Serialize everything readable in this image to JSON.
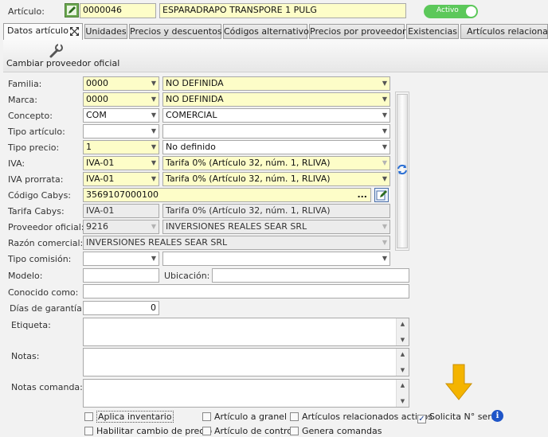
{
  "header": {
    "articulo_label": "Artículo:",
    "code": "0000046",
    "description": "ESPARADRAPO TRANSPORE 1 PULG",
    "toggle_label": "Activo"
  },
  "tabs": [
    {
      "label": "Datos artículo"
    },
    {
      "label": "Unidades"
    },
    {
      "label": "Precios y descuentos"
    },
    {
      "label": "Códigos alternativos"
    },
    {
      "label": "Precios por proveedor"
    },
    {
      "label": "Existencias"
    },
    {
      "label": "Artículos relacionados"
    }
  ],
  "toolbar": {
    "change_provider_label": "Cambiar proveedor oficial"
  },
  "form": {
    "familia": {
      "label": "Familia:",
      "code": "0000",
      "value": "NO DEFINIDA"
    },
    "marca": {
      "label": "Marca:",
      "code": "0000",
      "value": "NO DEFINIDA"
    },
    "concepto": {
      "label": "Concepto:",
      "code": "COM",
      "value": "COMERCIAL"
    },
    "tipo_articulo": {
      "label": "Tipo artículo:",
      "code": "",
      "value": ""
    },
    "tipo_precio": {
      "label": "Tipo precio:",
      "code": "1",
      "value": "No definido"
    },
    "iva": {
      "label": "IVA:",
      "code": "IVA-01",
      "value": "Tarifa 0% (Artículo 32, núm. 1, RLIVA)"
    },
    "iva_prorrata": {
      "label": "IVA prorrata:",
      "code": "IVA-01",
      "value": "Tarifa 0% (Artículo 32, núm. 1, RLIVA)"
    },
    "codigo_cabys": {
      "label": "Código Cabys:",
      "value": "3569107000100",
      "ellipsis": "..."
    },
    "tarifa_cabys": {
      "label": "Tarifa Cabys:",
      "code": "IVA-01",
      "value": "Tarifa 0% (Artículo 32, núm. 1, RLIVA)"
    },
    "proveedor_oficial": {
      "label": "Proveedor oficial:",
      "code": "9216",
      "value": "INVERSIONES REALES SEAR SRL"
    },
    "razon_comercial": {
      "label": "Razón comercial:",
      "value": "INVERSIONES REALES SEAR SRL"
    },
    "tipo_comision": {
      "label": "Tipo comisión:",
      "code": "",
      "value": ""
    },
    "modelo": {
      "label": "Modelo:",
      "value": ""
    },
    "ubicacion": {
      "label": "Ubicación:",
      "value": ""
    },
    "conocido_como": {
      "label": "Conocido como:",
      "value": ""
    },
    "dias_garantia": {
      "label": "Días de garantía:",
      "value": "0"
    },
    "etiqueta": {
      "label": "Etiqueta:"
    },
    "notas": {
      "label": "Notas:"
    },
    "notas_comanda": {
      "label": "Notas comanda:"
    }
  },
  "checkboxes": {
    "aplica_inventario": {
      "label": "Aplica inventario",
      "checked": false
    },
    "articulo_granel": {
      "label": "Artículo a granel",
      "checked": false
    },
    "articulos_relacionados": {
      "label": "Artículos relacionados activos",
      "checked": false
    },
    "solicita_serie": {
      "label": "Solicita N° serie",
      "checked": true
    },
    "habilitar_cambio_precio": {
      "label": "Habilitar cambio de precio",
      "checked": false
    },
    "articulo_control": {
      "label": "Artículo de control",
      "checked": false
    },
    "genera_comandas": {
      "label": "Genera comandas",
      "checked": false
    }
  },
  "colors": {
    "field_yellow": "#fdfdc8",
    "toggle_green": "#5cc85a",
    "arrow_orange": "#f4b400",
    "info_blue": "#1f55c8"
  }
}
